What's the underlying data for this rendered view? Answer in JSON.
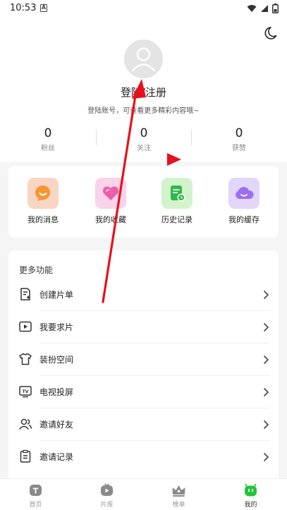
{
  "status_bar": {
    "time": "10:53"
  },
  "profile": {
    "login_title": "登陆/注册",
    "login_subtitle": "登陆账号，可查看更多精彩内容哦~",
    "stats": [
      {
        "value": "0",
        "label": "粉丝"
      },
      {
        "value": "0",
        "label": "关注"
      },
      {
        "value": "0",
        "label": "获赞"
      }
    ]
  },
  "quick_actions": [
    {
      "label": "我的消息",
      "icon": "message-icon",
      "color": "#f8d6c2"
    },
    {
      "label": "我的收藏",
      "icon": "heart-icon",
      "color": "#f9d3ea"
    },
    {
      "label": "历史记录",
      "icon": "history-icon",
      "color": "#d2f3cc"
    },
    {
      "label": "我的缓存",
      "icon": "cloud-icon",
      "color": "#e2d6fb"
    }
  ],
  "more": {
    "title": "更多功能",
    "items": [
      {
        "label": "创建片单",
        "icon": "create-list-icon"
      },
      {
        "label": "我要求片",
        "icon": "request-video-icon"
      },
      {
        "label": "装扮空间",
        "icon": "tshirt-icon"
      },
      {
        "label": "电视投屏",
        "icon": "tv-icon"
      },
      {
        "label": "邀请好友",
        "icon": "invite-friends-icon"
      },
      {
        "label": "邀请记录",
        "icon": "clipboard-icon"
      }
    ]
  },
  "tabs": [
    {
      "label": "首页",
      "icon": "home-icon",
      "active": false
    },
    {
      "label": "片库",
      "icon": "library-icon",
      "active": false
    },
    {
      "label": "榜单",
      "icon": "crown-icon",
      "active": false
    },
    {
      "label": "我的",
      "icon": "mine-icon",
      "active": true
    }
  ],
  "colors": {
    "accent": "#22c43a",
    "annotation": "#e8101c"
  }
}
